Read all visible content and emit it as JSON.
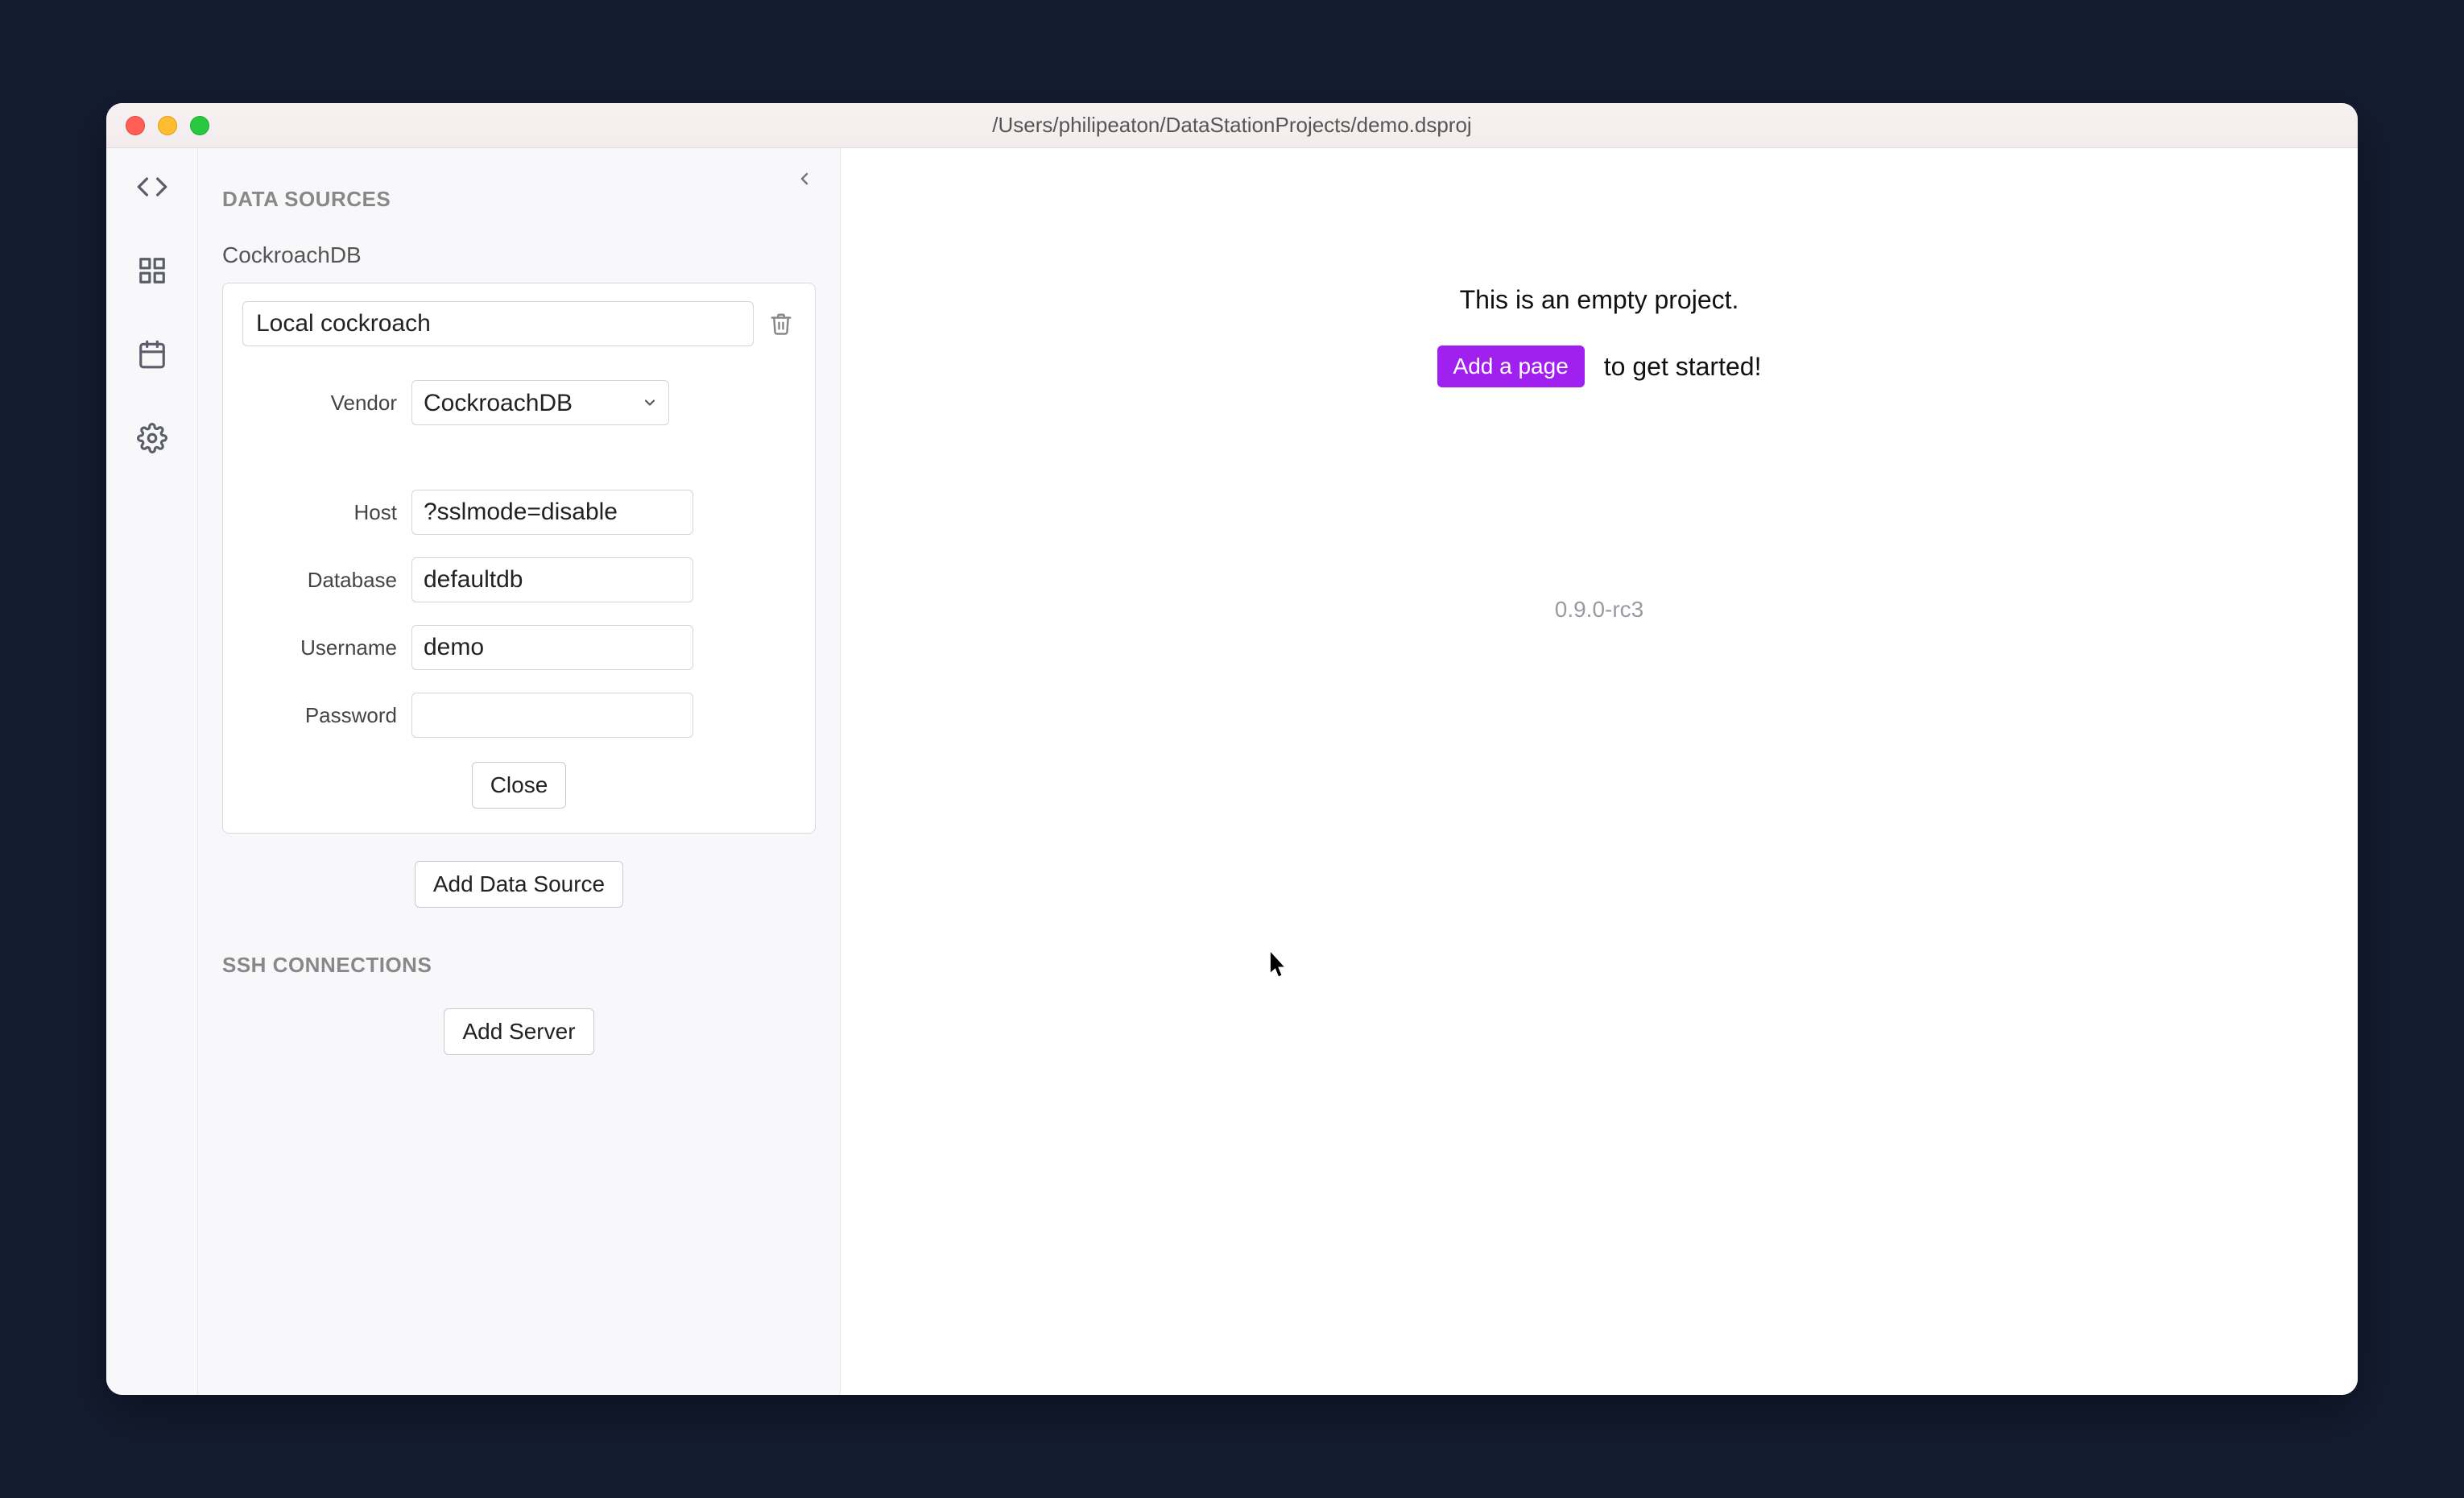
{
  "window": {
    "title": "/Users/philipeaton/DataStationProjects/demo.dsproj"
  },
  "iconbar": {
    "items": [
      "code",
      "dashboard",
      "calendar",
      "settings"
    ]
  },
  "sidebar": {
    "data_sources_heading": "DATA SOURCES",
    "ds_type_label": "CockroachDB",
    "ds_name": "Local cockroach",
    "vendor_label": "Vendor",
    "vendor_value": "CockroachDB",
    "host_label": "Host",
    "host_value": "?sslmode=disable",
    "database_label": "Database",
    "database_value": "defaultdb",
    "username_label": "Username",
    "username_value": "demo",
    "password_label": "Password",
    "password_value": "",
    "close_label": "Close",
    "add_ds_label": "Add Data Source",
    "ssh_heading": "SSH CONNECTIONS",
    "add_server_label": "Add Server"
  },
  "main": {
    "empty_text": "This is an empty project.",
    "add_page_label": "Add a page",
    "cta_tail": "to get started!",
    "version": "0.9.0-rc3"
  }
}
